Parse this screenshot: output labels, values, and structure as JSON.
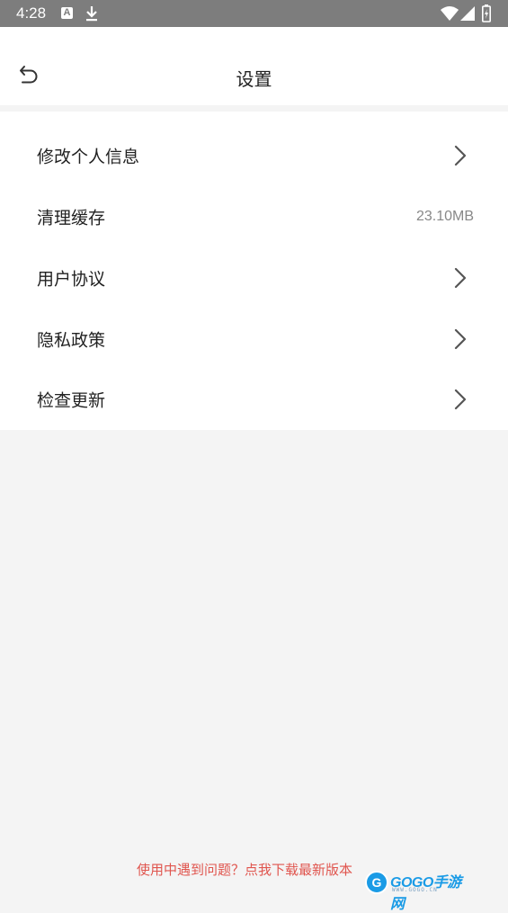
{
  "status_bar": {
    "time": "4:28",
    "notification_letter": "A",
    "icons": [
      "a-notification-icon",
      "download-icon",
      "wifi-icon",
      "signal-icon",
      "battery-icon"
    ]
  },
  "header": {
    "title": "设置",
    "back_icon": "back-icon"
  },
  "settings": {
    "items": [
      {
        "label": "修改个人信息",
        "type": "chevron"
      },
      {
        "label": "清理缓存",
        "value": "23.10MB"
      },
      {
        "label": "用户协议",
        "type": "chevron"
      },
      {
        "label": "隐私政策",
        "type": "chevron"
      },
      {
        "label": "检查更新",
        "type": "chevron"
      }
    ]
  },
  "footer": {
    "link_text": "使用中遇到问题？点我下载最新版本"
  },
  "watermark": {
    "logo_text": "GOGO手游网",
    "domain_text": "WWW.GOGO.CN"
  },
  "colors": {
    "status_bar": "#7d7d7d",
    "background": "#f4f4f4",
    "surface": "#ffffff",
    "text_primary": "#222222",
    "text_secondary": "#888888",
    "link": "#e0554e",
    "watermark_blue": "#1a9be6"
  }
}
